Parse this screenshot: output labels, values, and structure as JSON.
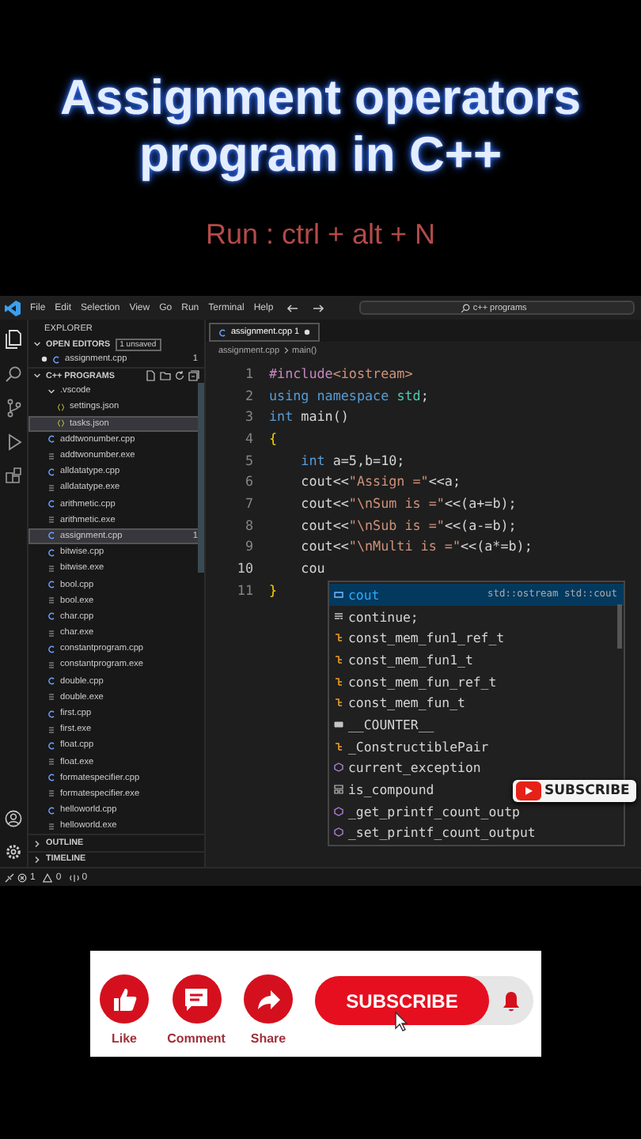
{
  "title": {
    "lines": [
      "Assignment operators",
      "program in C++"
    ],
    "hint": "Run : ctrl + alt + N"
  },
  "menu": [
    "File",
    "Edit",
    "Selection",
    "View",
    "Go",
    "Run",
    "Terminal",
    "Help"
  ],
  "search": {
    "value": "c++ programs"
  },
  "explorer": {
    "title": "EXPLORER",
    "open_editors": {
      "label": "OPEN EDITORS",
      "badge": "1 unsaved",
      "items": [
        {
          "name": "assignment.cpp",
          "unsaved": true,
          "problems": "1"
        }
      ]
    },
    "folder": {
      "label": "C++ PROGRAMS",
      "expanded": true,
      "items": [
        {
          "name": ".vscode",
          "kind": "folder",
          "expanded": true,
          "selected": false,
          "children": [
            {
              "name": "settings.json",
              "kind": "json",
              "selected": false
            },
            {
              "name": "tasks.json",
              "kind": "json",
              "selected": true
            }
          ]
        },
        {
          "name": "addtwonumber.cpp",
          "kind": "cpp",
          "selected": false
        },
        {
          "name": "addtwonumber.exe",
          "kind": "exe",
          "selected": false
        },
        {
          "name": "alldatatype.cpp",
          "kind": "cpp",
          "selected": false
        },
        {
          "name": "alldatatype.exe",
          "kind": "exe",
          "selected": false
        },
        {
          "name": "arithmetic.cpp",
          "kind": "cpp",
          "selected": false
        },
        {
          "name": "arithmetic.exe",
          "kind": "exe",
          "selected": false
        },
        {
          "name": "assignment.cpp",
          "kind": "cpp",
          "selected": true,
          "problems": "1"
        },
        {
          "name": "bitwise.cpp",
          "kind": "cpp",
          "selected": false
        },
        {
          "name": "bitwise.exe",
          "kind": "exe",
          "selected": false
        },
        {
          "name": "bool.cpp",
          "kind": "cpp",
          "selected": false
        },
        {
          "name": "bool.exe",
          "kind": "exe",
          "selected": false
        },
        {
          "name": "char.cpp",
          "kind": "cpp",
          "selected": false
        },
        {
          "name": "char.exe",
          "kind": "exe",
          "selected": false
        },
        {
          "name": "constantprogram.cpp",
          "kind": "cpp",
          "selected": false
        },
        {
          "name": "constantprogram.exe",
          "kind": "exe",
          "selected": false
        },
        {
          "name": "double.cpp",
          "kind": "cpp",
          "selected": false
        },
        {
          "name": "double.exe",
          "kind": "exe",
          "selected": false
        },
        {
          "name": "first.cpp",
          "kind": "cpp",
          "selected": false
        },
        {
          "name": "first.exe",
          "kind": "exe",
          "selected": false
        },
        {
          "name": "float.cpp",
          "kind": "cpp",
          "selected": false
        },
        {
          "name": "float.exe",
          "kind": "exe",
          "selected": false
        },
        {
          "name": "formatespecifier.cpp",
          "kind": "cpp",
          "selected": false
        },
        {
          "name": "formatespecifier.exe",
          "kind": "exe",
          "selected": false
        },
        {
          "name": "helloworld.cpp",
          "kind": "cpp",
          "selected": false
        },
        {
          "name": "helloworld.exe",
          "kind": "exe",
          "selected": false
        }
      ]
    },
    "sections": [
      {
        "label": "OUTLINE",
        "expanded": false
      },
      {
        "label": "TIMELINE",
        "expanded": false
      }
    ]
  },
  "tab": {
    "name": "assignment.cpp",
    "problems": "1",
    "unsaved": true,
    "selected": true
  },
  "breadcrumbs": [
    "assignment.cpp",
    "main()"
  ],
  "code": [
    {
      "number": "1",
      "tokens": [
        {
          "text": "#include",
          "kind": "directive"
        },
        {
          "text": "<iostream>",
          "kind": "string"
        }
      ]
    },
    {
      "number": "2",
      "tokens": [
        {
          "text": "using namespace ",
          "kind": "keyword"
        },
        {
          "text": "std",
          "kind": "type"
        },
        {
          "text": ";",
          "kind": "plain"
        }
      ]
    },
    {
      "number": "3",
      "tokens": [
        {
          "text": "int ",
          "kind": "keyword"
        },
        {
          "text": "main()",
          "kind": "plain"
        }
      ]
    },
    {
      "number": "4",
      "tokens": [
        {
          "text": "{",
          "kind": "bracket"
        }
      ]
    },
    {
      "number": "5",
      "tokens": [
        {
          "text": "    int ",
          "kind": "keyword"
        },
        {
          "text": "a=5,b=10;",
          "kind": "plain"
        }
      ]
    },
    {
      "number": "6",
      "tokens": [
        {
          "text": "    cout<<",
          "kind": "plain"
        },
        {
          "text": "\"Assign =\"",
          "kind": "string"
        },
        {
          "text": "<<a;",
          "kind": "plain"
        }
      ]
    },
    {
      "number": "7",
      "tokens": [
        {
          "text": "    cout<<",
          "kind": "plain"
        },
        {
          "text": "\"\\nSum is =\"",
          "kind": "string"
        },
        {
          "text": "<<(a+=b);",
          "kind": "plain"
        }
      ]
    },
    {
      "number": "8",
      "tokens": [
        {
          "text": "    cout<<",
          "kind": "plain"
        },
        {
          "text": "\"\\nSub is =\"",
          "kind": "string"
        },
        {
          "text": "<<(a-=b);",
          "kind": "plain"
        }
      ]
    },
    {
      "number": "9",
      "tokens": [
        {
          "text": "    cout<<",
          "kind": "plain"
        },
        {
          "text": "\"\\nMulti is =\"",
          "kind": "string"
        },
        {
          "text": "<<(a*=b);",
          "kind": "plain"
        }
      ]
    },
    {
      "number": "10",
      "current": true,
      "tokens": [
        {
          "text": "    cou",
          "kind": "plain"
        }
      ]
    },
    {
      "number": "11",
      "tokens": [
        {
          "text": "}",
          "kind": "bracket"
        }
      ]
    }
  ],
  "suggestions": [
    {
      "label": "cout",
      "kind": "variable",
      "detail": "std::ostream std::cout",
      "selected": true
    },
    {
      "label": "continue;",
      "kind": "snippet",
      "selected": false
    },
    {
      "label": "const_mem_fun1_ref_t",
      "kind": "class",
      "selected": false
    },
    {
      "label": "const_mem_fun1_t",
      "kind": "class",
      "selected": false
    },
    {
      "label": "const_mem_fun_ref_t",
      "kind": "class",
      "selected": false
    },
    {
      "label": "const_mem_fun_t",
      "kind": "class",
      "selected": false
    },
    {
      "label": "__COUNTER__",
      "kind": "macro",
      "selected": false
    },
    {
      "label": "_ConstructiblePair",
      "kind": "class",
      "selected": false
    },
    {
      "label": "current_exception",
      "kind": "function",
      "selected": false
    },
    {
      "label": "is_compound",
      "kind": "struct",
      "selected": false
    },
    {
      "label": "_get_printf_count_outp",
      "kind": "function",
      "selected": false
    },
    {
      "label": "_set_printf_count_output",
      "kind": "function",
      "selected": false
    }
  ],
  "sticker": {
    "label": "SUBSCRIBE"
  },
  "status": {
    "errors": "1",
    "warnings": "0",
    "ports": "0"
  },
  "card": {
    "actions": [
      "Like",
      "Comment",
      "Share"
    ],
    "subscribe": "SUBSCRIBE"
  }
}
